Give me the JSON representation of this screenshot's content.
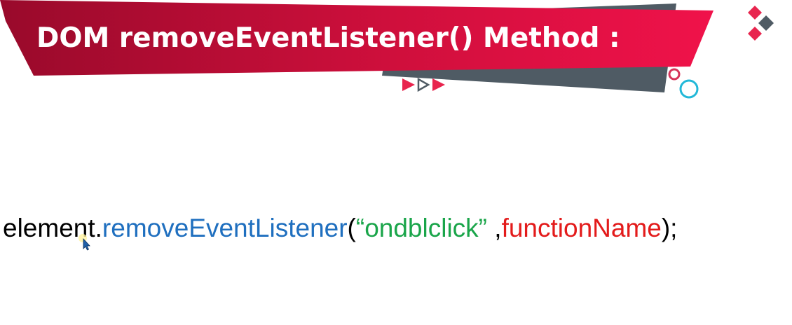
{
  "slide": {
    "title": "DOM removeEventListener() Method :",
    "colors": {
      "banner_dark": "#9b0a2c",
      "banner_light": "#ee1145",
      "banner_shadow": "#4f5b64",
      "accent_red": "#e8254e",
      "accent_gray": "#4f5b64",
      "circle_cyan": "#22b8d8",
      "circle_red": "#d6345a"
    },
    "icons": [
      "diamond-logo-icon",
      "play-arrows-icon",
      "decorative-circles-icon",
      "mouse-cursor-icon"
    ]
  },
  "code": {
    "object": "element",
    "dot": ".",
    "method": "removeEventListener",
    "open_paren": "(",
    "event_string": "“ondblclick”",
    "separator": " ,",
    "handler": "functionName",
    "close": ");"
  }
}
